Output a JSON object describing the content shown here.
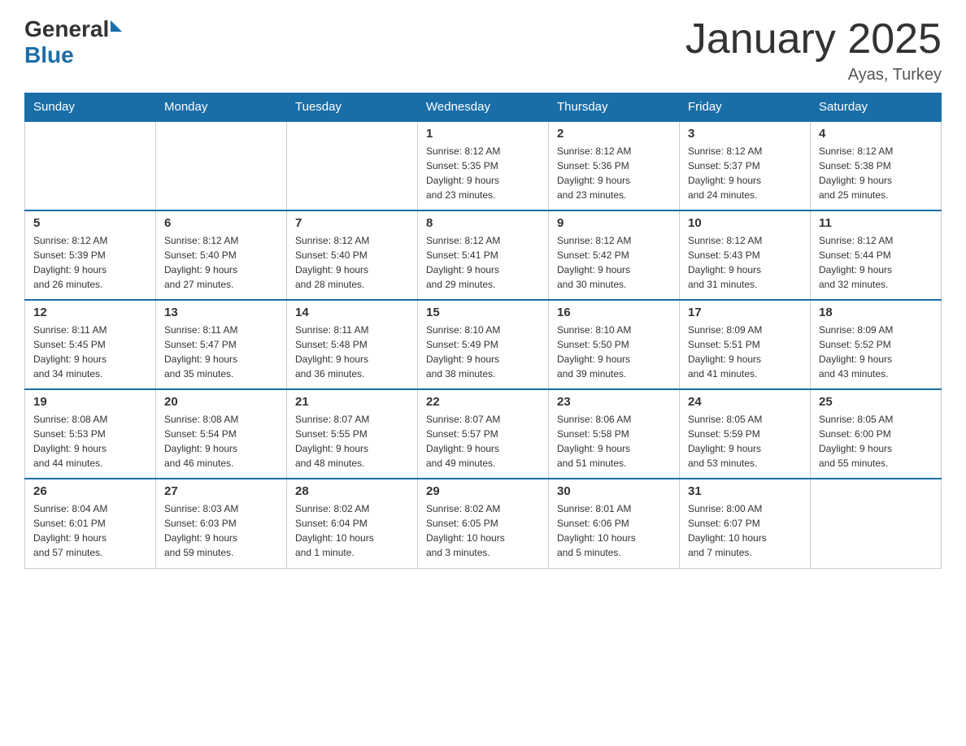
{
  "header": {
    "logo_general": "General",
    "logo_blue": "Blue",
    "title": "January 2025",
    "subtitle": "Ayas, Turkey"
  },
  "days_of_week": [
    "Sunday",
    "Monday",
    "Tuesday",
    "Wednesday",
    "Thursday",
    "Friday",
    "Saturday"
  ],
  "weeks": [
    [
      {
        "day": "",
        "info": ""
      },
      {
        "day": "",
        "info": ""
      },
      {
        "day": "",
        "info": ""
      },
      {
        "day": "1",
        "info": "Sunrise: 8:12 AM\nSunset: 5:35 PM\nDaylight: 9 hours\nand 23 minutes."
      },
      {
        "day": "2",
        "info": "Sunrise: 8:12 AM\nSunset: 5:36 PM\nDaylight: 9 hours\nand 23 minutes."
      },
      {
        "day": "3",
        "info": "Sunrise: 8:12 AM\nSunset: 5:37 PM\nDaylight: 9 hours\nand 24 minutes."
      },
      {
        "day": "4",
        "info": "Sunrise: 8:12 AM\nSunset: 5:38 PM\nDaylight: 9 hours\nand 25 minutes."
      }
    ],
    [
      {
        "day": "5",
        "info": "Sunrise: 8:12 AM\nSunset: 5:39 PM\nDaylight: 9 hours\nand 26 minutes."
      },
      {
        "day": "6",
        "info": "Sunrise: 8:12 AM\nSunset: 5:40 PM\nDaylight: 9 hours\nand 27 minutes."
      },
      {
        "day": "7",
        "info": "Sunrise: 8:12 AM\nSunset: 5:40 PM\nDaylight: 9 hours\nand 28 minutes."
      },
      {
        "day": "8",
        "info": "Sunrise: 8:12 AM\nSunset: 5:41 PM\nDaylight: 9 hours\nand 29 minutes."
      },
      {
        "day": "9",
        "info": "Sunrise: 8:12 AM\nSunset: 5:42 PM\nDaylight: 9 hours\nand 30 minutes."
      },
      {
        "day": "10",
        "info": "Sunrise: 8:12 AM\nSunset: 5:43 PM\nDaylight: 9 hours\nand 31 minutes."
      },
      {
        "day": "11",
        "info": "Sunrise: 8:12 AM\nSunset: 5:44 PM\nDaylight: 9 hours\nand 32 minutes."
      }
    ],
    [
      {
        "day": "12",
        "info": "Sunrise: 8:11 AM\nSunset: 5:45 PM\nDaylight: 9 hours\nand 34 minutes."
      },
      {
        "day": "13",
        "info": "Sunrise: 8:11 AM\nSunset: 5:47 PM\nDaylight: 9 hours\nand 35 minutes."
      },
      {
        "day": "14",
        "info": "Sunrise: 8:11 AM\nSunset: 5:48 PM\nDaylight: 9 hours\nand 36 minutes."
      },
      {
        "day": "15",
        "info": "Sunrise: 8:10 AM\nSunset: 5:49 PM\nDaylight: 9 hours\nand 38 minutes."
      },
      {
        "day": "16",
        "info": "Sunrise: 8:10 AM\nSunset: 5:50 PM\nDaylight: 9 hours\nand 39 minutes."
      },
      {
        "day": "17",
        "info": "Sunrise: 8:09 AM\nSunset: 5:51 PM\nDaylight: 9 hours\nand 41 minutes."
      },
      {
        "day": "18",
        "info": "Sunrise: 8:09 AM\nSunset: 5:52 PM\nDaylight: 9 hours\nand 43 minutes."
      }
    ],
    [
      {
        "day": "19",
        "info": "Sunrise: 8:08 AM\nSunset: 5:53 PM\nDaylight: 9 hours\nand 44 minutes."
      },
      {
        "day": "20",
        "info": "Sunrise: 8:08 AM\nSunset: 5:54 PM\nDaylight: 9 hours\nand 46 minutes."
      },
      {
        "day": "21",
        "info": "Sunrise: 8:07 AM\nSunset: 5:55 PM\nDaylight: 9 hours\nand 48 minutes."
      },
      {
        "day": "22",
        "info": "Sunrise: 8:07 AM\nSunset: 5:57 PM\nDaylight: 9 hours\nand 49 minutes."
      },
      {
        "day": "23",
        "info": "Sunrise: 8:06 AM\nSunset: 5:58 PM\nDaylight: 9 hours\nand 51 minutes."
      },
      {
        "day": "24",
        "info": "Sunrise: 8:05 AM\nSunset: 5:59 PM\nDaylight: 9 hours\nand 53 minutes."
      },
      {
        "day": "25",
        "info": "Sunrise: 8:05 AM\nSunset: 6:00 PM\nDaylight: 9 hours\nand 55 minutes."
      }
    ],
    [
      {
        "day": "26",
        "info": "Sunrise: 8:04 AM\nSunset: 6:01 PM\nDaylight: 9 hours\nand 57 minutes."
      },
      {
        "day": "27",
        "info": "Sunrise: 8:03 AM\nSunset: 6:03 PM\nDaylight: 9 hours\nand 59 minutes."
      },
      {
        "day": "28",
        "info": "Sunrise: 8:02 AM\nSunset: 6:04 PM\nDaylight: 10 hours\nand 1 minute."
      },
      {
        "day": "29",
        "info": "Sunrise: 8:02 AM\nSunset: 6:05 PM\nDaylight: 10 hours\nand 3 minutes."
      },
      {
        "day": "30",
        "info": "Sunrise: 8:01 AM\nSunset: 6:06 PM\nDaylight: 10 hours\nand 5 minutes."
      },
      {
        "day": "31",
        "info": "Sunrise: 8:00 AM\nSunset: 6:07 PM\nDaylight: 10 hours\nand 7 minutes."
      },
      {
        "day": "",
        "info": ""
      }
    ]
  ]
}
